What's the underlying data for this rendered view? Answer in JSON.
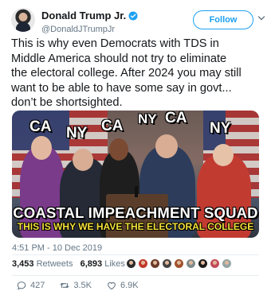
{
  "author": {
    "display_name": "Donald Trump Jr.",
    "handle": "@DonaldJTrumpJr",
    "verified": true
  },
  "follow_button": {
    "label": "Follow"
  },
  "tweet": {
    "text_lines": [
      "This is why even Democrats with TDS in",
      "Middle America should not try to eliminate",
      "the electoral college. After 2024 you may still",
      "want to be able to have some say in govt...",
      "don’t be shortsighted."
    ],
    "timestamp": "4:51 PM - 10 Dec 2019"
  },
  "media": {
    "state_labels": [
      "CA",
      "NY",
      "CA",
      "NY",
      "CA",
      "NY"
    ],
    "headline": "COASTAL IMPEACHMENT SQUAD",
    "subheadline": "THIS IS WHY WE HAVE THE ELECTORAL COLLEGE"
  },
  "stats": {
    "retweets_count": "3,453",
    "retweets_label": "Retweets",
    "likes_count": "6,893",
    "likes_label": "Likes",
    "liker_colors": [
      "#2b2b2b",
      "#c0392b",
      "#6b3b2a",
      "#444444",
      "#a0522d",
      "#7f8c8d",
      "#1c1c1c",
      "#c24b5a",
      "#95a5a6"
    ]
  },
  "actions": {
    "replies": "427",
    "retweets": "3.5K",
    "likes": "6.9K"
  },
  "colors": {
    "accent": "#1da1f2",
    "secondary_text": "#657786",
    "banner_yellow": "#f4e23a"
  },
  "icons": [
    "verified-badge-icon",
    "chevron-down-icon",
    "reply-icon",
    "retweet-icon",
    "like-icon"
  ]
}
